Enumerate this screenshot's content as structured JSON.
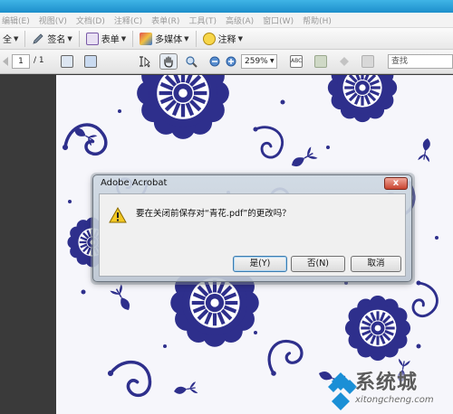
{
  "menubar": {
    "items": [
      "编辑(E)",
      "视图(V)",
      "文档(D)",
      "注释(C)",
      "表单(R)",
      "工具(T)",
      "高级(A)",
      "窗口(W)",
      "帮助(H)"
    ]
  },
  "toolbar1": {
    "items": [
      {
        "label": "全",
        "icon": "combine-icon"
      },
      {
        "label": "签名",
        "icon": "pen-icon"
      },
      {
        "label": "表单",
        "icon": "form-icon"
      },
      {
        "label": "多媒体",
        "icon": "multimedia-icon"
      },
      {
        "label": "注释",
        "icon": "comment-icon"
      }
    ]
  },
  "toolbar2": {
    "page_current": "1",
    "page_total": "/ 1",
    "zoom": "259%",
    "find_placeholder": "查找"
  },
  "dialog": {
    "title": "Adobe Acrobat",
    "message": "要在关闭前保存对“青花.pdf”的更改吗？",
    "yes_label": "是(Y)",
    "no_label": "否(N)",
    "cancel_label": "取消",
    "close_symbol": "x"
  },
  "watermark": {
    "text": "系统城",
    "url": "xitongcheng.com"
  },
  "colors": {
    "pattern_blue": "#2e2f8c",
    "title_blue": "#1d8fcb",
    "close_red": "#c8442f"
  }
}
